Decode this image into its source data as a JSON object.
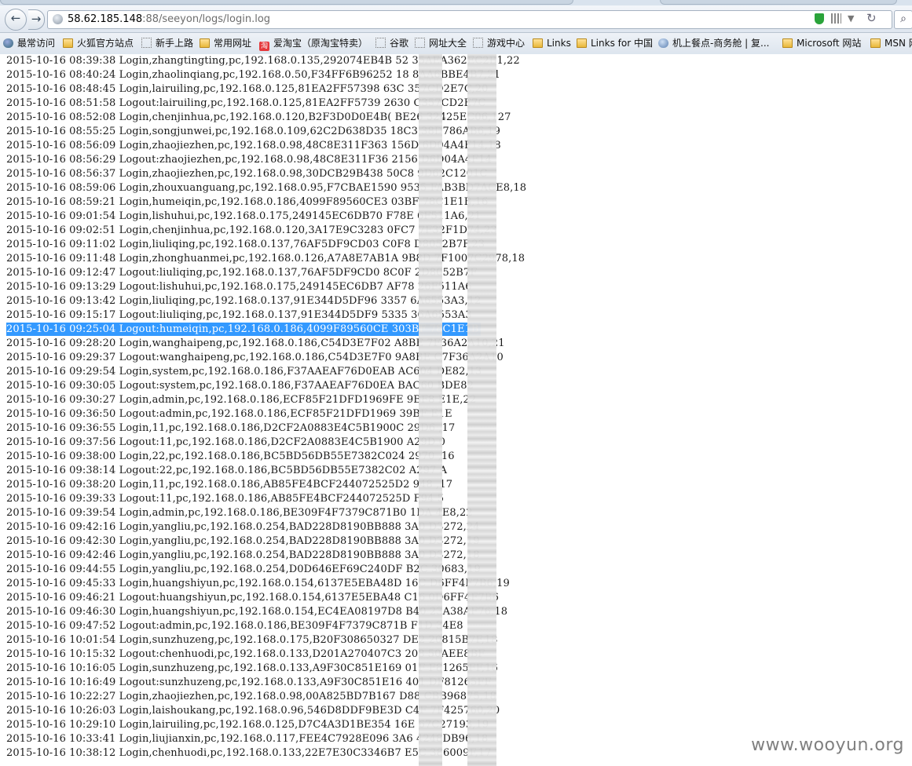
{
  "browser": {
    "url_host": "58.62.185.148",
    "url_rest": ":88/seeyon/logs/login.log"
  },
  "bookmarks": [
    {
      "label": "最常访问",
      "icon": "globe"
    },
    {
      "label": "火狐官方站点",
      "icon": "folder"
    },
    {
      "label": "新手上路",
      "icon": "dotted"
    },
    {
      "label": "常用网址",
      "icon": "folder"
    },
    {
      "label": "爱淘宝（原淘宝特卖）",
      "icon": "taobao"
    },
    {
      "label": "谷歌",
      "icon": "dotted"
    },
    {
      "label": "网址大全",
      "icon": "dotted"
    },
    {
      "label": "游戏中心",
      "icon": "dotted"
    },
    {
      "label": "Links",
      "icon": "folder"
    },
    {
      "label": "Links for 中国",
      "icon": "folder"
    },
    {
      "label": "机上餐点-商务舱 | 复...",
      "icon": "blue"
    },
    {
      "label": "Microsoft 网站",
      "icon": "folder"
    },
    {
      "label": "MSN 网",
      "icon": "folder"
    }
  ],
  "log_lines": [
    "2015-10-16 08:39:38 Login,zhangtingting,pc,192.168.0.135,292074EB4B       52    35AEA362EC2B1,22",
    "2015-10-16 08:40:24 Login,zhaolinqiang,pc,192.168.0.50,F34FF6B96252     18    8AA6BBE4B7,21",
    "2015-10-16 08:48:45 Login,lairuiling,pc,192.168.0.125,81EA2FF57398      63C    357CD2E7C,20",
    "2015-10-16 08:51:58 Logout:lairuiling,pc,192.168.0.125,81EA2FF5739      2630   C357CD2E7C",
    "2015-10-16 08:52:08 Login,chenjinhua,pc,192.168.0.120,B2F3D0D0E4B(      BE26    32425EC06,127",
    "2015-10-16 08:55:25 Login,songjunwei,pc,192.168.0.109,62C2D638D35      18C3    38D786AB6,19",
    "2015-10-16 08:56:09 Login,zhaojiezhen,pc,192.168.0.98,48C8E311F363     156D    6D04A4F14,18",
    "2015-10-16 08:56:29 Logout:zhaojiezhen,pc,192.168.0.98,48C8E311F36     2156    D6D04A4F14",
    "2015-10-16 08:56:37 Login,zhaojiezhen,pc,192.168.0.98,30DCB29B438      50C8    9D62C1201C",
    "2015-10-16 08:59:06 Login,zhouxuanguang,pc,192.168.0.95,F7CBAE1590      9535    FAB3BD7ACE8,18",
    "2015-10-16 08:59:21 Login,humeiqin,pc,192.168.0.186,4099F89560CE3      03BF    78C1E1B,16",
    "2015-10-16 09:01:54 Login,lishuhui,pc,192.168.0.175,249145EC6DB70      F78E    6F511A6,21",
    "2015-10-16 09:02:51 Login,chenjinhua,pc,192.168.0.120,3A17E9C3283      0FC7    7F32F1D74,23",
    "2015-10-16 09:11:02 Login,liuliqing,pc,192.168.0.137,76AF5DF9CD03      C0F8    D8052B7F,23",
    "2015-10-16 09:11:48 Login,zhonghuanmei,pc,192.168.0.126,A7A8E7AB1A      9B8D    7F1007C2978,18",
    "2015-10-16 09:12:47 Logout:liuliqing,pc,192.168.0.137,76AF5DF9CD0      8C0F    2D8052B7F",
    "2015-10-16 09:13:29 Logout:lishuhui,pc,192.168.0.175,249145EC6DB7      AF78    26F511A6",
    "2015-10-16 09:13:42 Login,liuliqing,pc,192.168.0.137,91E344D5DF96      3357    6A6553A3,12",
    "2015-10-16 09:15:17 Logout:liuliqing,pc,192.168.0.137,91E344D5DF9      5335    36A6553A3",
    "2015-10-16 09:25:04 Logout:humeiqin,pc,192.168.0.186,4099F89560CE      303BF   78C1E1B",
    "2015-10-16 09:28:20 Login,wanghaipeng,pc,192.168.0.186,C54D3E7F02      A8BE    7F36A2A10,21",
    "2015-10-16 09:29:37 Logout:wanghaipeng,pc,192.168.0.186,C54D3E7F0      9A8BE   C7F36A2A10",
    "2015-10-16 09:29:54 Login,system,pc,192.168.0.186,F37AAEAF76D0EAB      AC604   DE82,13",
    "2015-10-16 09:30:05 Logout:system,pc,192.168.0.186,F37AAEAF76D0EA      BAC60   BDE82",
    "2015-10-16 09:30:27 Login,admin,pc,192.168.0.186,ECF85F21DFD1969FE      9BF8    E1E,22",
    "2015-10-16 09:36:50 Logout:admin,pc,192.168.0.186,ECF85F21DFD1969      39BF    E1E",
    "2015-10-16 09:36:55 Login,11,pc,192.168.0.186,D2CF2A0883E4C5B1900C      29D6    ,17",
    "2015-10-16 09:37:56 Logout:11,pc,192.168.0.186,D2CF2A0883E4C5B1900      A29D    0",
    "2015-10-16 09:38:00 Login,22,pc,192.168.0.186,BC5BD56DB55E7382C024      2970    ,16",
    "2015-10-16 09:38:14 Logout:22,pc,192.168.0.186,BC5BD56DB55E7382C02      A297    A",
    "2015-10-16 09:38:20 Login,11,pc,192.168.0.186,AB85FE4BCF244072525D2      948     ,17",
    "2015-10-16 09:39:33 Logout:11,pc,192.168.0.186,AB85FE4BCF244072525D      F94     5",
    "2015-10-16 09:39:54 Login,admin,pc,192.168.0.186,BE309F4F7379C871B0      1DA     4E8,22",
    "2015-10-16 09:42:16 Login,yangliu,pc,192.168.0.254,BAD228D8190BB888      3A0     D3272,24",
    "2015-10-16 09:42:30 Login,yangliu,pc,192.168.0.254,BAD228D8190BB888      3A0     D3272,19",
    "2015-10-16 09:42:46 Login,yangliu,pc,192.168.0.254,BAD228D8190BB888      3A0     D3272,18",
    "2015-10-16 09:44:55 Login,yangliu,pc,192.168.0.254,D0D646EF69C240DF      B2C     30683,19",
    "2015-10-16 09:45:33 Login,huangshiyun,pc,192.168.0.154,6137E5EBA48D      16C     D6FF4F7B6,19",
    "2015-10-16 09:46:21 Logout:huangshiyun,pc,192.168.0.154,6137E5EBA48      C16     0D6FF4F7B6",
    "2015-10-16 09:46:30 Login,huangshiyun,pc,192.168.0.154,EC4EA08197D8      B40     23A38AF76,18",
    "2015-10-16 09:47:52 Logout:admin,pc,192.168.0.186,BE309F4F7379C871B      F1D     34E8",
    "2015-10-16 10:01:54 Login,sunzhuzeng,pc,192.168.0.175,B20F308650327      DE2     20815B7F,18",
    "2015-10-16 10:15:32 Logout:chenhuodi,pc,192.168.0.133,D201A270407C3      208     50AEE8BF",
    "2015-10-16 10:16:05 Login,sunzhuzeng,pc,192.168.0.133,A9F30C851E169      01F     F81265FF,16",
    "2015-10-16 10:16:49 Logout:sunzhuzeng,pc,192.168.0.133,A9F30C851E16      401     DF81265FF",
    "2015-10-16 10:22:27 Login,zhaojiezhen,pc,192.168.0.98,00A825BD7B167      D88     CBB96875,18",
    "2015-10-16 10:26:03 Login,laishoukang,pc,192.168.0.96,546D8DDF9BE3D      C4F     7F425760,20",
    "2015-10-16 10:29:10 Login,lairuiling,pc,192.168.0.125,D7C4A3D1BE354      16E     67C27193,19",
    "2015-10-16 10:33:41 Login,liujianxin,pc,192.168.0.117,FEE4C7928E096      3A6     4248DB96,18",
    "2015-10-16 10:38:12 Login,chenhuodi,pc,192.168.0.133,22E7E30C3346B7      E5C     386009F,17"
  ],
  "selected_line_index": 19,
  "watermark": "www.wooyun.org",
  "colors": {
    "selection": "#3399ff",
    "shield": "#2aa33a"
  }
}
